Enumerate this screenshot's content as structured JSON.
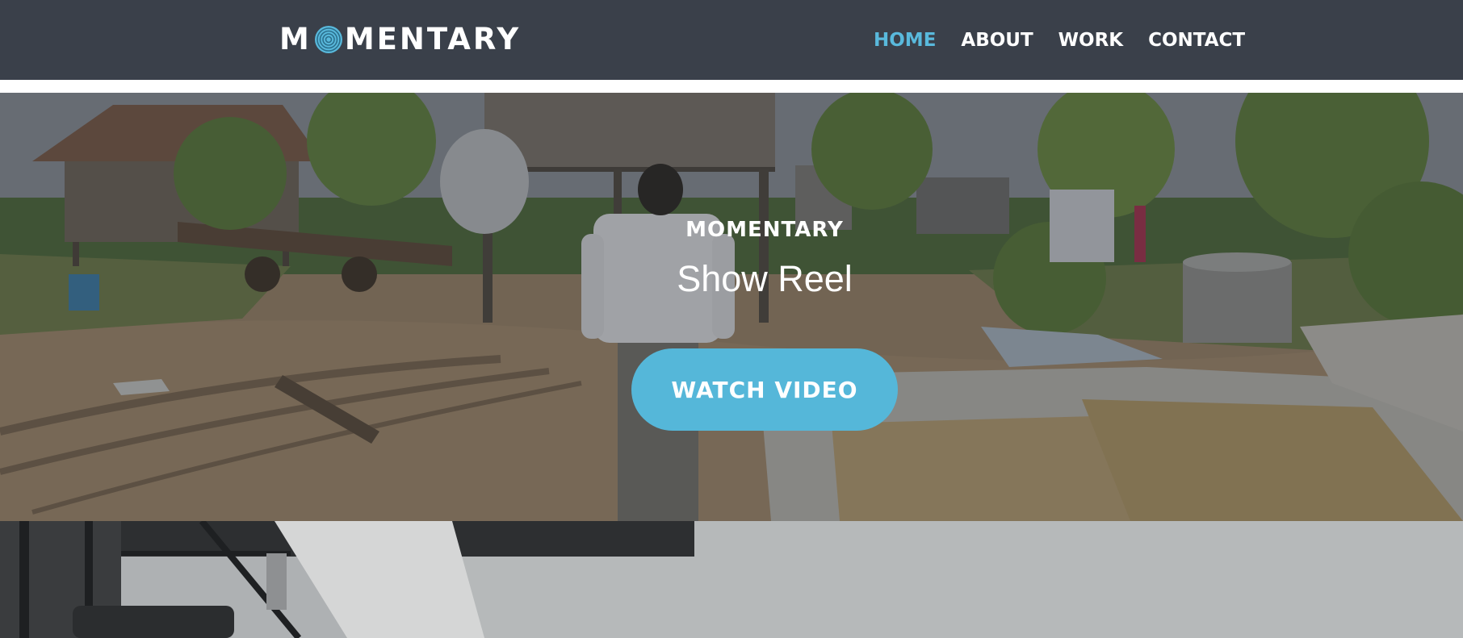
{
  "header": {
    "logo": {
      "before_o": "M",
      "after_o": "MENTARY",
      "full_text": "MOMENTARY",
      "o_icon": "concentric-rings-icon",
      "text_color": "#ffffff",
      "icon_color": "#59b9dc"
    },
    "nav": [
      {
        "label": "HOME",
        "active": true
      },
      {
        "label": "ABOUT",
        "active": false
      },
      {
        "label": "WORK",
        "active": false
      },
      {
        "label": "CONTACT",
        "active": false
      }
    ],
    "background": "#3a404a",
    "active_color": "#59b9dc"
  },
  "hero": {
    "kicker": "MOMENTARY",
    "title": "Show Reel",
    "button_label": "WATCH VIDEO",
    "button_color": "#55b7d9"
  }
}
